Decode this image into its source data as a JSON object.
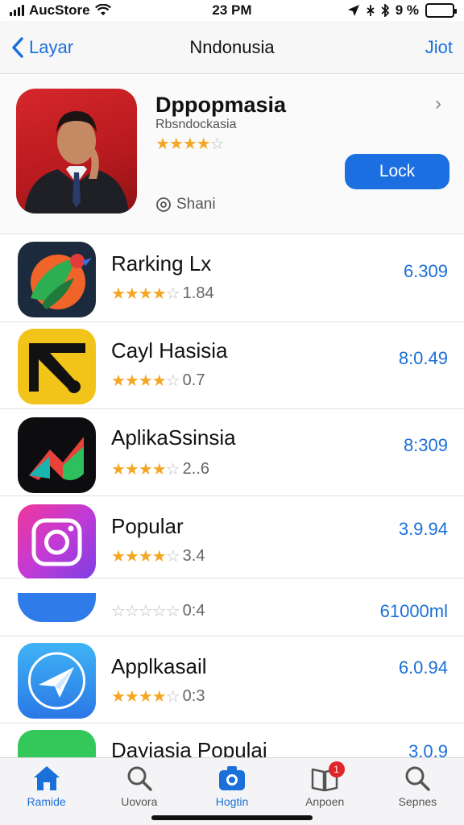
{
  "status_bar": {
    "carrier": "AucStore",
    "time": "23 PM",
    "battery": "9 %",
    "battery_level": 0.9
  },
  "nav": {
    "back_label": "Layar",
    "title": "Nndonusia",
    "action_label": "Jiot"
  },
  "featured": {
    "title": "Dppopmasia",
    "subtitle": "Rbsndockasia",
    "rating_stars": 3.5,
    "button_label": "Lock",
    "meta": "Shani"
  },
  "apps": [
    {
      "name": "Rarking Lx",
      "rating_stars": 4,
      "rating_value": "1.84",
      "price": "6.309",
      "icon": "colorful-bird-icon"
    },
    {
      "name": "Cayl Hasisia",
      "rating_stars": 4,
      "rating_value": "0.7",
      "price": "8:0.49",
      "icon": "yellow-arrow-icon"
    },
    {
      "name": "AplikaSsinsia",
      "rating_stars": 4,
      "rating_value": "2..6",
      "price": "8:309",
      "icon": "dark-arrow-icon"
    },
    {
      "name": "Popular",
      "rating_stars": 4,
      "rating_value": "3.4",
      "price": "3.9.94",
      "icon": "camera-gradient-icon"
    },
    {
      "name": "",
      "rating_stars": 0,
      "rating_value": "0:4",
      "price": "61000ml",
      "icon": "blue-partial-icon"
    },
    {
      "name": "Applkasail",
      "rating_stars": 4,
      "rating_value": "0:3",
      "price": "6.0.94",
      "icon": "paper-plane-icon"
    },
    {
      "name": "Dayiasia Populai",
      "rating_stars": 0,
      "rating_value": "",
      "price": "3.0.9",
      "icon": "green-app-icon"
    }
  ],
  "tabs": [
    {
      "label": "Ramide",
      "icon": "home-icon",
      "active": true
    },
    {
      "label": "Uovora",
      "icon": "search-icon",
      "active": false
    },
    {
      "label": "Hogtin",
      "icon": "camera-icon",
      "active": true
    },
    {
      "label": "Anpoen",
      "icon": "book-icon",
      "active": false,
      "badge": "1"
    },
    {
      "label": "Sepnes",
      "icon": "search-icon",
      "active": false
    }
  ],
  "colors": {
    "accent": "#1a6fd8",
    "star": "#f5a623",
    "button": "#1c6fe0"
  }
}
